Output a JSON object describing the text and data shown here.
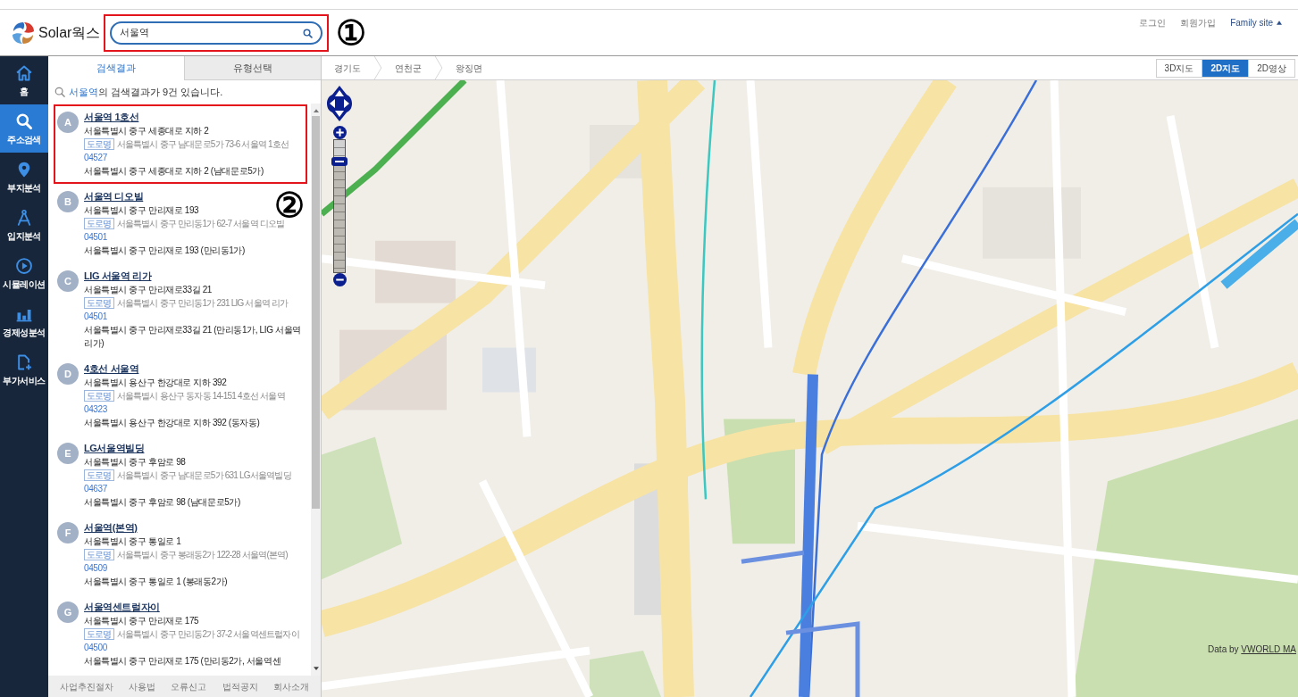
{
  "header": {
    "logo_text": "Solar웍스",
    "search": {
      "value": "서울역",
      "highlighted": true
    },
    "links": [
      {
        "label": "로그인",
        "kind": "plain"
      },
      {
        "label": "회원가입",
        "kind": "plain"
      },
      {
        "label": "Family site",
        "kind": "menu"
      }
    ]
  },
  "callouts": [
    {
      "label": "①"
    },
    {
      "label": "②"
    }
  ],
  "sidebar": {
    "items": [
      {
        "label": "홈",
        "selected": false
      },
      {
        "label": "주소검색",
        "selected": true
      },
      {
        "label": "부지분석",
        "selected": false
      },
      {
        "label": "입지분석",
        "selected": false
      },
      {
        "label": "시뮬레이션",
        "selected": false
      },
      {
        "label": "경제성분석",
        "selected": false
      },
      {
        "label": "부가서비스",
        "selected": false
      }
    ]
  },
  "panel": {
    "tabs": [
      {
        "label": "검색결과",
        "selected": true
      },
      {
        "label": "유형선택",
        "selected": false
      }
    ],
    "summary": {
      "query": "서울역",
      "text": "의 검색결과가 9건 있습니다."
    },
    "results": [
      {
        "marker": "A",
        "title": "서울역 1호선",
        "road_address": "서울특별시 중구 세종대로 지하 2",
        "badge": "도로명",
        "lot_address": "서울특별시 중구 남대문로5가 73-6 서울역 1호선",
        "postal_code": "04527",
        "full_address": "서울특별시 중구 세종대로 지하 2 (남대문로5가)",
        "highlighted": true
      },
      {
        "marker": "B",
        "title": "서울역 디오빌",
        "road_address": "서울특별시 중구 만리재로 193",
        "badge": "도로명",
        "lot_address": "서울특별시 중구 만리동1가 62-7 서울역 디오빌",
        "postal_code": "04501",
        "full_address": "서울특별시 중구 만리재로 193 (만리동1가)",
        "highlighted": false
      },
      {
        "marker": "C",
        "title": "LIG 서울역 리가",
        "road_address": "서울특별시 중구 만리재로33길 21",
        "badge": "도로명",
        "lot_address": "서울특별시 중구 만리동1가 231 LIG 서울역 리가",
        "postal_code": "04501",
        "full_address": "서울특별시 중구 만리재로33길 21 (만리동1가, LIG 서울역 리가)",
        "highlighted": false
      },
      {
        "marker": "D",
        "title": "4호선 서울역",
        "road_address": "서울특별시 용산구 한강대로 지하 392",
        "badge": "도로명",
        "lot_address": "서울특별시 용산구 동자동 14-151 4호선 서울역",
        "postal_code": "04323",
        "full_address": "서울특별시 용산구 한강대로 지하 392 (동자동)",
        "highlighted": false
      },
      {
        "marker": "E",
        "title": "LG서울역빌딩",
        "road_address": "서울특별시 중구 후암로 98",
        "badge": "도로명",
        "lot_address": "서울특별시 중구 남대문로5가 631 LG서울역빌딩",
        "postal_code": "04637",
        "full_address": "서울특별시 중구 후암로 98 (남대문로5가)",
        "highlighted": false
      },
      {
        "marker": "F",
        "title": "서울역(본역)",
        "road_address": "서울특별시 중구 통일로 1",
        "badge": "도로명",
        "lot_address": "서울특별시 중구 봉래동2가 122-28 서울역(본역)",
        "postal_code": "04509",
        "full_address": "서울특별시 중구 통일로 1 (봉래동2가)",
        "highlighted": false
      },
      {
        "marker": "G",
        "title": "서울역센트럴자이",
        "road_address": "서울특별시 중구 만리재로 175",
        "badge": "도로명",
        "lot_address": "서울특별시 중구 만리동2가 37-2 서울역센트럴자이",
        "postal_code": "04500",
        "full_address": "서울특별시 중구 만리재로 175 (만리동2가, 서울역센",
        "highlighted": false
      }
    ],
    "footer_links": [
      "사업추진절차",
      "사용법",
      "오류신고",
      "법적공지",
      "회사소개"
    ]
  },
  "map": {
    "breadcrumb": [
      "경기도",
      "연천군",
      "왕징면"
    ],
    "view_modes": [
      {
        "label": "3D지도",
        "selected": false
      },
      {
        "label": "2D지도",
        "selected": true
      },
      {
        "label": "2D영상",
        "selected": false
      }
    ],
    "zoom": {
      "level": 0.84
    },
    "attribution": {
      "text": "Data by",
      "link": "VWORLD MA"
    }
  }
}
